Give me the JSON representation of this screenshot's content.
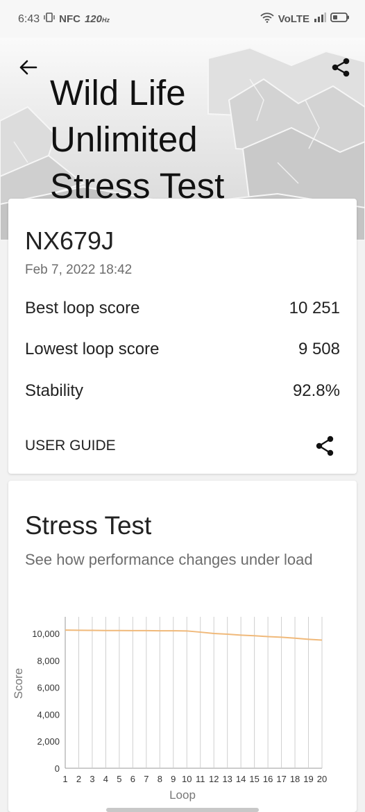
{
  "status_bar": {
    "time": "6:43",
    "nfc": "NFC",
    "refresh": "120",
    "refresh_unit": "Hz",
    "network": "VoLTE"
  },
  "header": {
    "title_lines": [
      "Wild Life",
      "Unlimited",
      "Stress Test"
    ],
    "back_icon": "back-arrow-icon",
    "share_icon": "share-icon"
  },
  "summary": {
    "device": "NX679J",
    "date": "Feb 7, 2022 18:42",
    "rows": [
      {
        "label": "Best loop score",
        "value": "10 251"
      },
      {
        "label": "Lowest loop score",
        "value": "9 508"
      },
      {
        "label": "Stability",
        "value": "92.8%"
      }
    ],
    "user_guide": "USER GUIDE"
  },
  "stress": {
    "title": "Stress Test",
    "subtitle": "See how performance changes under load"
  },
  "chart_data": {
    "type": "line",
    "x": [
      1,
      2,
      3,
      4,
      5,
      6,
      7,
      8,
      9,
      10,
      11,
      12,
      13,
      14,
      15,
      16,
      17,
      18,
      19,
      20
    ],
    "series": [
      {
        "values": [
          10251,
          10240,
          10230,
          10220,
          10220,
          10215,
          10210,
          10200,
          10200,
          10190,
          10100,
          10000,
          9950,
          9880,
          9830,
          9770,
          9720,
          9650,
          9570,
          9508
        ]
      }
    ],
    "xlabel": "Loop",
    "ylabel": "Score",
    "ylim": [
      0,
      10000
    ],
    "yticks": [
      "0",
      "2,000",
      "4,000",
      "6,000",
      "8,000",
      "10,000"
    ],
    "ytick_values": [
      0,
      2000,
      4000,
      6000,
      8000,
      10000
    ],
    "grid": "vertical",
    "line_color": "#f0b97a"
  }
}
